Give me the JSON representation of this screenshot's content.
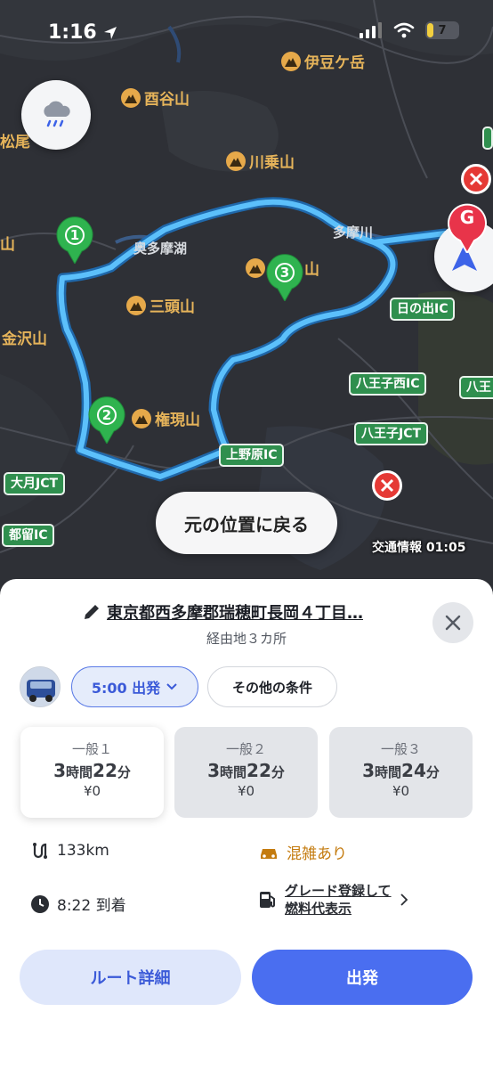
{
  "status": {
    "time": "1:16",
    "battery": "7"
  },
  "map": {
    "mountains": {
      "izugatake": "伊豆ケ岳",
      "nishitaniyama": "酉谷山",
      "kawanoriyama": "川乗山",
      "mitouzan": "三頭山",
      "gongenyama": "権現山",
      "hidden_mountain": "山"
    },
    "places": {
      "okutamako": "奥多摩湖",
      "tamagawa": "多摩川",
      "left_yama": "山",
      "left_kanezawa": "金沢山",
      "left_matsuo": "松尾"
    },
    "interchanges": {
      "hinode": "日の出IC",
      "hachioji_nishi": "八王子西IC",
      "hachioji_right": "八王",
      "hachioji_jct": "八王子JCT",
      "uenohara": "上野原IC",
      "otsuki_jct": "大月JCT",
      "tsuru": "都留IC"
    },
    "waypoints": [
      "1",
      "2",
      "3"
    ],
    "goal": "G",
    "return_button": "元の位置に戻る",
    "traffic_info": "交通情報 01:05",
    "route_color": "#4fb3f5"
  },
  "sheet": {
    "destination": "東京都西多摩郡瑞穂町長岡４丁目…",
    "via": "経由地３カ所",
    "depart_label": "5:00 出発",
    "other_conditions": "その他の条件",
    "routes": [
      {
        "name": "一般１",
        "hours": "3",
        "minutes": "22",
        "h_unit": "時間",
        "m_unit": "分",
        "cost": "¥0"
      },
      {
        "name": "一般２",
        "hours": "3",
        "minutes": "22",
        "h_unit": "時間",
        "m_unit": "分",
        "cost": "¥0"
      },
      {
        "name": "一般３",
        "hours": "3",
        "minutes": "24",
        "h_unit": "時間",
        "m_unit": "分",
        "cost": "¥0"
      }
    ],
    "distance": "133km",
    "congestion": "混雑あり",
    "arrival": "8:22 到着",
    "fuel_line1": "グレード登録して",
    "fuel_line2": "燃料代表示",
    "route_detail_button": "ルート詳細",
    "start_button": "出発"
  }
}
